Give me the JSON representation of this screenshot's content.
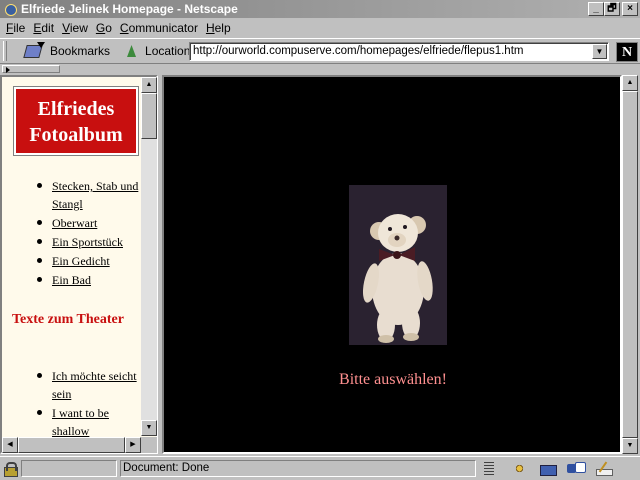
{
  "window": {
    "title": "Elfriede Jelinek Homepage - Netscape",
    "buttons": [
      "_",
      "🗗",
      "×"
    ]
  },
  "menubar": {
    "items": [
      {
        "label": "File",
        "accel": "F",
        "rest": "ile"
      },
      {
        "label": "Edit",
        "accel": "E",
        "rest": "dit"
      },
      {
        "label": "View",
        "accel": "V",
        "rest": "iew"
      },
      {
        "label": "Go",
        "accel": "G",
        "rest": "o"
      },
      {
        "label": "Communicator",
        "accel": "C",
        "rest": "ommunicator"
      },
      {
        "label": "Help",
        "accel": "H",
        "rest": "elp"
      }
    ]
  },
  "toolbar": {
    "bookmarks_label": "Bookmarks",
    "location_label": "Location:",
    "url": "http://ourworld.compuserve.com/homepages/elfriede/flepus1.htm",
    "netscape_logo": "N"
  },
  "left_frame": {
    "album_title_line1": "Elfriedes",
    "album_title_line2": "Fotoalbum",
    "links": [
      {
        "label": "Stecken, Stab und Stangl"
      },
      {
        "label": "Oberwart"
      },
      {
        "label": "Ein Sportstück"
      },
      {
        "label": "Ein Gedicht"
      },
      {
        "label": "Ein Bad"
      }
    ],
    "section_heading": "Texte zum Theater",
    "links2": [
      {
        "label": "Ich möchte seicht sein"
      },
      {
        "label": "I want to be shallow"
      }
    ]
  },
  "right_frame": {
    "choose_text": "Bitte auswählen!",
    "background": "#000000",
    "text_color": "#ff9090"
  },
  "statusbar": {
    "status_text": "Document: Done"
  },
  "colors": {
    "album_red": "#c80f0f",
    "heading_red": "#c80f0f",
    "left_bg": "#fffaeb",
    "chrome": "#c0c0c0"
  }
}
